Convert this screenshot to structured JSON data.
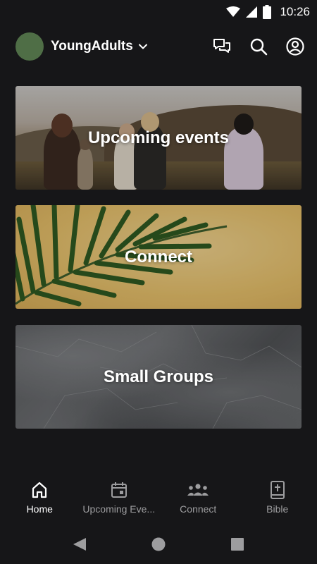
{
  "status_bar": {
    "time": "10:26",
    "icons": [
      "wifi-icon",
      "signal-icon",
      "battery-icon"
    ]
  },
  "header": {
    "group_name": "YoungAdults",
    "avatar_color": "#4f6e46",
    "actions": [
      "chat-icon",
      "search-icon",
      "account-icon"
    ]
  },
  "cards": [
    {
      "label": "Upcoming events"
    },
    {
      "label": "Connect"
    },
    {
      "label": "Small Groups"
    }
  ],
  "bottom_nav": {
    "items": [
      {
        "label": "Home",
        "icon": "home-icon",
        "active": true
      },
      {
        "label": "Upcoming Eve...",
        "icon": "calendar-icon",
        "active": false
      },
      {
        "label": "Connect",
        "icon": "people-icon",
        "active": false
      },
      {
        "label": "Bible",
        "icon": "bible-icon",
        "active": false
      }
    ]
  },
  "system_nav": [
    "back-icon",
    "home-circle-icon",
    "recents-icon"
  ],
  "colors": {
    "background": "#161618",
    "active_text": "#ffffff",
    "inactive_text": "#9d9d9f"
  }
}
